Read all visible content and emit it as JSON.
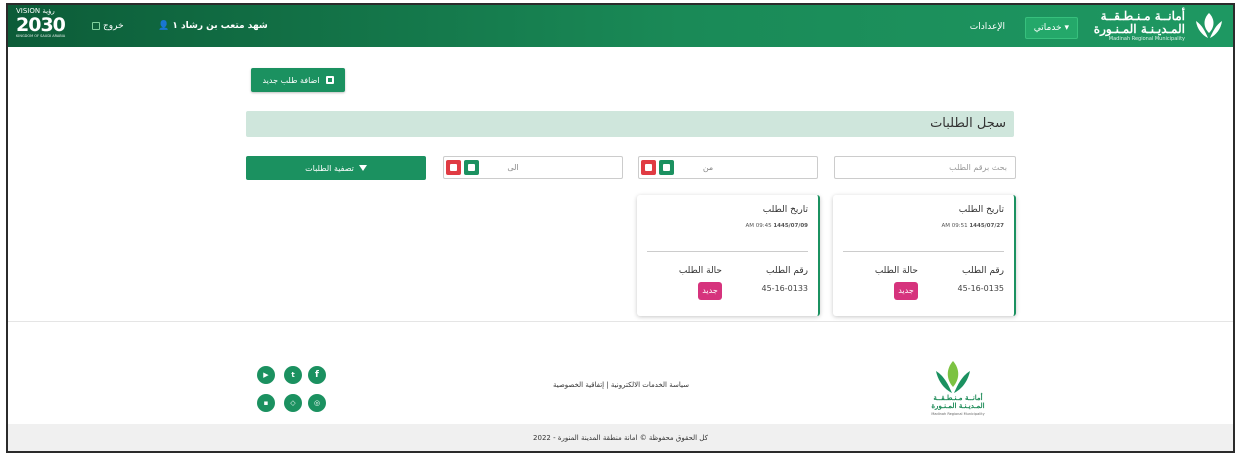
{
  "header": {
    "brand_line1": "أمانــة مـنـطـقــة",
    "brand_line2": "المـديـنـة المـنـورة",
    "brand_line3": "Madinah Regional Municipality",
    "services_label": "خدماتي ▾",
    "settings_label": "الإعدادات",
    "username": "شهد متعب بن رشاد ١",
    "logout_label": "خروج",
    "vision_line1": "VISION رؤية",
    "vision_line2": "2030",
    "vision_line3": "KINGDOM OF SAUDI ARABIA"
  },
  "actions": {
    "add_request_label": "اضافة طلب جديد"
  },
  "page": {
    "title": "سجل الطلبات"
  },
  "filters": {
    "search_placeholder": "بحث برقم الطلب",
    "from_label": "من",
    "to_label": "الى",
    "filter_button_label": "تصفية الطلبات"
  },
  "requests": [
    {
      "date_label": "تاريخ الطلب",
      "date_time": "AM 09:51",
      "date_value": "1445/07/27",
      "number_label": "رقم الطلب",
      "number": "45-16-0135",
      "status_label": "حالة الطلب",
      "status": "جديد"
    },
    {
      "date_label": "تاريخ الطلب",
      "date_time": "AM 09:45",
      "date_value": "1445/07/09",
      "number_label": "رقم الطلب",
      "number": "45-16-0133",
      "status_label": "حالة الطلب",
      "status": "جديد"
    }
  ],
  "footer": {
    "brand_line1": "أمانــة مـنـطـقــة",
    "brand_line2": "المـديـنـة المـنـورة",
    "brand_line3": "Madinah Regional Municipality",
    "links": "سياسة الخدمات الالكترونية | إتفاقية الخصوصية",
    "copyright": "كل الحقوق محفوظة © امانة منطقة المدينة المنورة - 2022",
    "social": [
      {
        "icon": "facebook-icon",
        "glyph": "f"
      },
      {
        "icon": "twitter-icon",
        "glyph": "t"
      },
      {
        "icon": "youtube-icon",
        "glyph": "▶"
      },
      {
        "icon": "instagram-icon",
        "glyph": "◎"
      },
      {
        "icon": "snapchat-icon",
        "glyph": "◇"
      },
      {
        "icon": "linkedin-icon",
        "glyph": "▪"
      }
    ]
  },
  "colors": {
    "primary_green": "#1b9160",
    "header_dark": "#0c5c38",
    "title_bar": "#cfe6dc",
    "danger_red": "#e03b43",
    "status_new": "#d6337d"
  }
}
